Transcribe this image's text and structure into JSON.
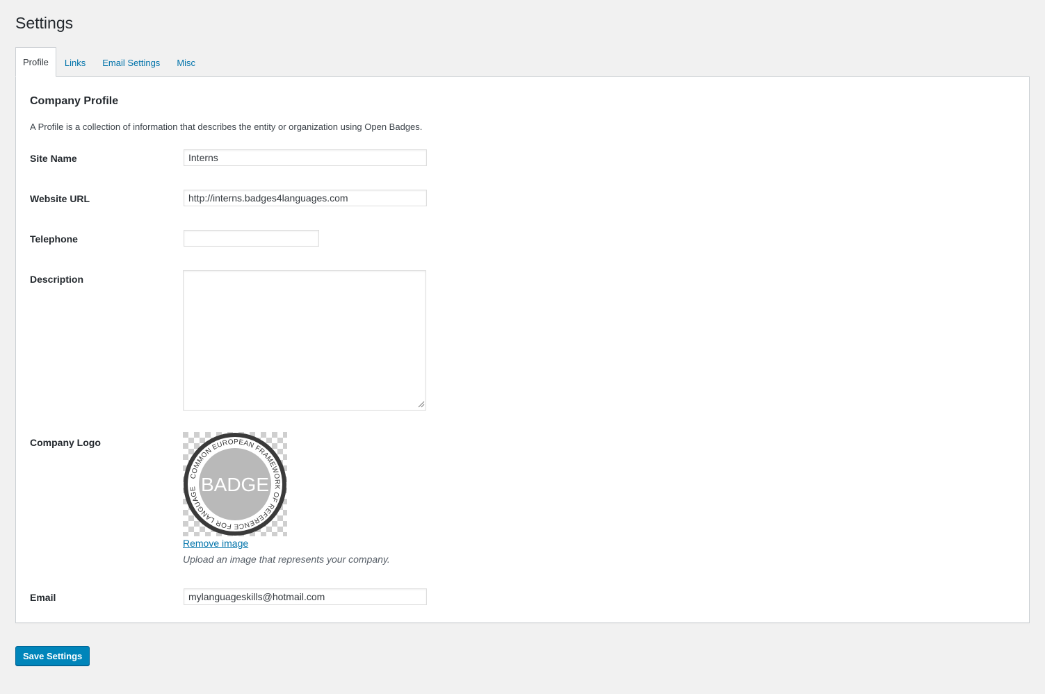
{
  "page": {
    "title": "Settings"
  },
  "tabs": [
    {
      "label": "Profile",
      "active": true
    },
    {
      "label": "Links",
      "active": false
    },
    {
      "label": "Email Settings",
      "active": false
    },
    {
      "label": "Misc",
      "active": false
    }
  ],
  "profile": {
    "heading": "Company Profile",
    "description": "A Profile is a collection of information that describes the entity or organization using Open Badges.",
    "site_name": {
      "label": "Site Name",
      "value": "Interns"
    },
    "website_url": {
      "label": "Website URL",
      "value": "http://interns.badges4languages.com"
    },
    "telephone": {
      "label": "Telephone",
      "value": ""
    },
    "description_field": {
      "label": "Description",
      "value": ""
    },
    "logo": {
      "label": "Company Logo",
      "badge_text": "BADGE",
      "ring_text": "COMMON EUROPEAN FRAMEWORK OF REFERENCE FOR LANGUAGES",
      "remove_label": "Remove image",
      "hint": "Upload an image that represents your company."
    },
    "email": {
      "label": "Email",
      "value": "mylanguageskills@hotmail.com"
    }
  },
  "actions": {
    "save_label": "Save Settings"
  },
  "colors": {
    "primary_button": "#0085ba",
    "link": "#0073aa",
    "background": "#f1f1f1"
  }
}
